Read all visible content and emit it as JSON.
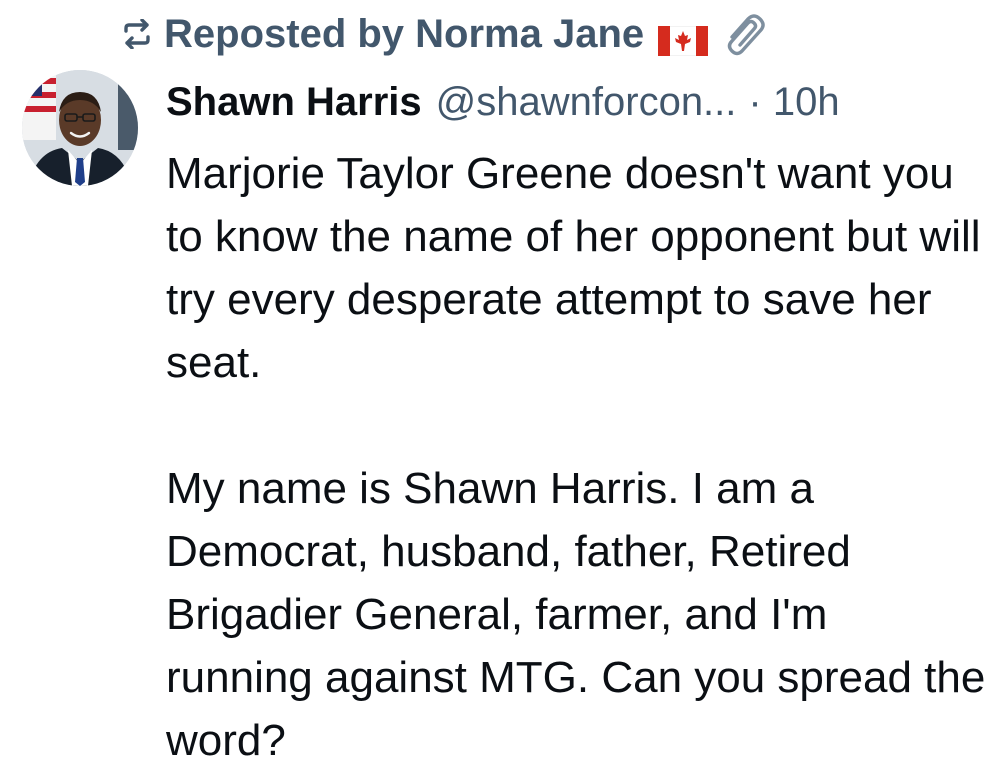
{
  "repost": {
    "text": "Reposted by Norma Jane",
    "icon": "repost-icon",
    "flag_icon": "canada-flag-icon",
    "emoji_icon": "paperclip-icon"
  },
  "post": {
    "author_name": "Shawn Harris",
    "handle": "@shawnforcon...",
    "time": "· 10h",
    "avatar_icon": "avatar-photo",
    "paragraphs": [
      "Marjorie Taylor Greene doesn't want you to know the name of her opponent but will try every desperate attempt to save her seat.",
      "My name is Shawn Harris. I am a Democrat, husband, father, Retired Brigadier General, farmer, and I'm running against MTG. Can you spread the word?"
    ]
  },
  "colors": {
    "text_primary": "#0b0f14",
    "text_secondary": "#42576c",
    "background": "#ffffff",
    "flag_red": "#d52b1e"
  }
}
